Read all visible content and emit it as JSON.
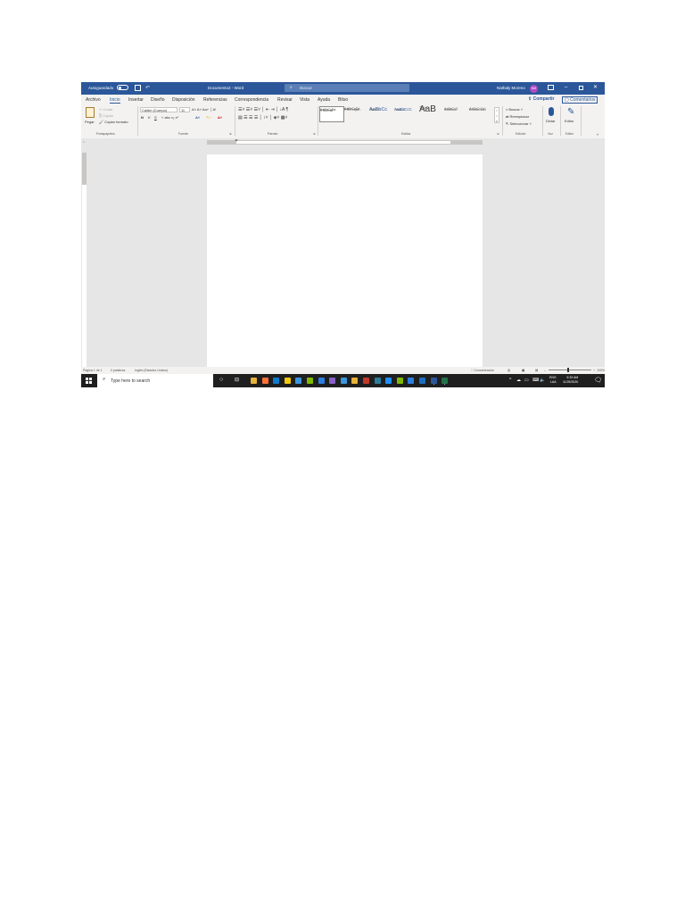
{
  "title_bar": {
    "autosave_label": "Autoguardado",
    "doc_title": "Documento2 - Word",
    "search_placeholder": "Buscar",
    "user_name": "Nathaly Moreno",
    "avatar_initials": "NM",
    "accent_color": "#2b579a"
  },
  "tabs": {
    "items": [
      {
        "label": "Archivo"
      },
      {
        "label": "Inicio"
      },
      {
        "label": "Insertar"
      },
      {
        "label": "Diseño"
      },
      {
        "label": "Disposición"
      },
      {
        "label": "Referencias"
      },
      {
        "label": "Correspondencia"
      },
      {
        "label": "Revisar"
      },
      {
        "label": "Vista"
      },
      {
        "label": "Ayuda"
      },
      {
        "label": "Bitso"
      }
    ],
    "active_tab": "Inicio",
    "share_label": "Compartir",
    "comments_label": "Comentarios"
  },
  "ribbon": {
    "clipboard": {
      "paste_label": "Pegar",
      "cut_label": "Cortar",
      "copy_label": "Copiar",
      "format_painter_label": "Copiar formato",
      "group_label": "Portapapeles"
    },
    "font": {
      "font_name": "Calibri (Cuerpo)",
      "font_size": "11",
      "bold": "N",
      "italic": "K",
      "underline": "S",
      "group_label": "Fuente"
    },
    "paragraph": {
      "group_label": "Párrafo"
    },
    "styles": {
      "items": [
        {
          "preview": "AaBbCcDd",
          "name": "¶ Normal"
        },
        {
          "preview": "AaBbCcDd",
          "name": "¶ Sin espa..."
        },
        {
          "preview": "AaBbCc",
          "name": "Título 1"
        },
        {
          "preview": "AaBbCcC",
          "name": "Título 2"
        },
        {
          "preview": "AaB",
          "name": "Título"
        },
        {
          "preview": "AaBbCcD",
          "name": "Subtítulo"
        },
        {
          "preview": "AaBbCcDd",
          "name": "Énfasis sutil"
        }
      ],
      "group_label": "Estilos"
    },
    "editing": {
      "find_label": "Buscar",
      "replace_label": "Reemplazar",
      "select_label": "Seleccionar",
      "group_label": "Edición"
    },
    "voice": {
      "dictate_label": "Dictar",
      "group_label": "Voz"
    },
    "editor": {
      "editor_label": "Editor",
      "group_label": "Editor"
    }
  },
  "status_bar": {
    "page_info": "Página 1 de 1",
    "word_count": "0 palabras",
    "language": "Inglés (Estados Unidos)",
    "focus_label": "Concentración",
    "zoom": "100%"
  },
  "taskbar": {
    "search_placeholder": "Type here to search",
    "language": "ENG",
    "region": "LAA",
    "time": "9:33 AM",
    "date": "11/25/2020",
    "app_colors": [
      "#e8b339",
      "#ff7139",
      "#0f7bcd",
      "#f2c811",
      "#3a96dd",
      "#7fba00",
      "#2a7fe0",
      "#8661c5",
      "#3a96dd",
      "#e8b339",
      "#c23a2b",
      "#2d7d9a",
      "#1e90ff",
      "#7fba00",
      "#2a7fe0",
      "#1b6ec2",
      "#2b579a",
      "#217346"
    ]
  }
}
